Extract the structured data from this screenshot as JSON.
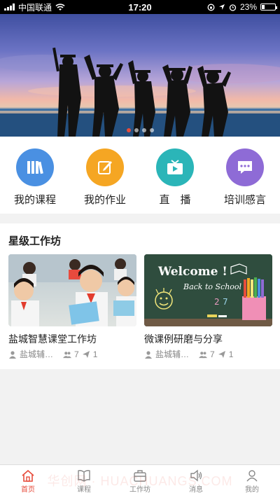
{
  "status_bar": {
    "carrier": "中国联通",
    "time": "17:20",
    "battery": "23%",
    "battery_level": 0.23
  },
  "banner": {
    "active_slide": 1,
    "slide_count": 4
  },
  "quick_menu": [
    {
      "label": "我的课程",
      "icon": "bookshelf-icon",
      "color": "#4a90e2"
    },
    {
      "label": "我的作业",
      "icon": "edit-note-icon",
      "color": "#f5a623"
    },
    {
      "label": "直　播",
      "icon": "tv-play-icon",
      "color": "#2bb5b8"
    },
    {
      "label": "培训感言",
      "icon": "chat-bubble-icon",
      "color": "#8e6bd6"
    }
  ],
  "workshop": {
    "title": "星级工作坊",
    "cards": [
      {
        "title": "盐城智慧课堂工作坊",
        "owner": "盐城辅…",
        "members": "7",
        "posts": "1"
      },
      {
        "title": "微课例研磨与分享",
        "owner": "盐城辅…",
        "members": "7",
        "posts": "1"
      }
    ],
    "chalkboard": {
      "line1": "Welcome !",
      "line2": "Back to School"
    }
  },
  "tabbar": [
    {
      "label": "首页",
      "icon": "home-icon",
      "active": true
    },
    {
      "label": "课程",
      "icon": "book-icon",
      "active": false
    },
    {
      "label": "工作坊",
      "icon": "briefcase-icon",
      "active": false
    },
    {
      "label": "消息",
      "icon": "speaker-icon",
      "active": false
    },
    {
      "label": "我的",
      "icon": "user-icon",
      "active": false
    }
  ],
  "watermark": "华创网 · HUACHUANGS.COM"
}
